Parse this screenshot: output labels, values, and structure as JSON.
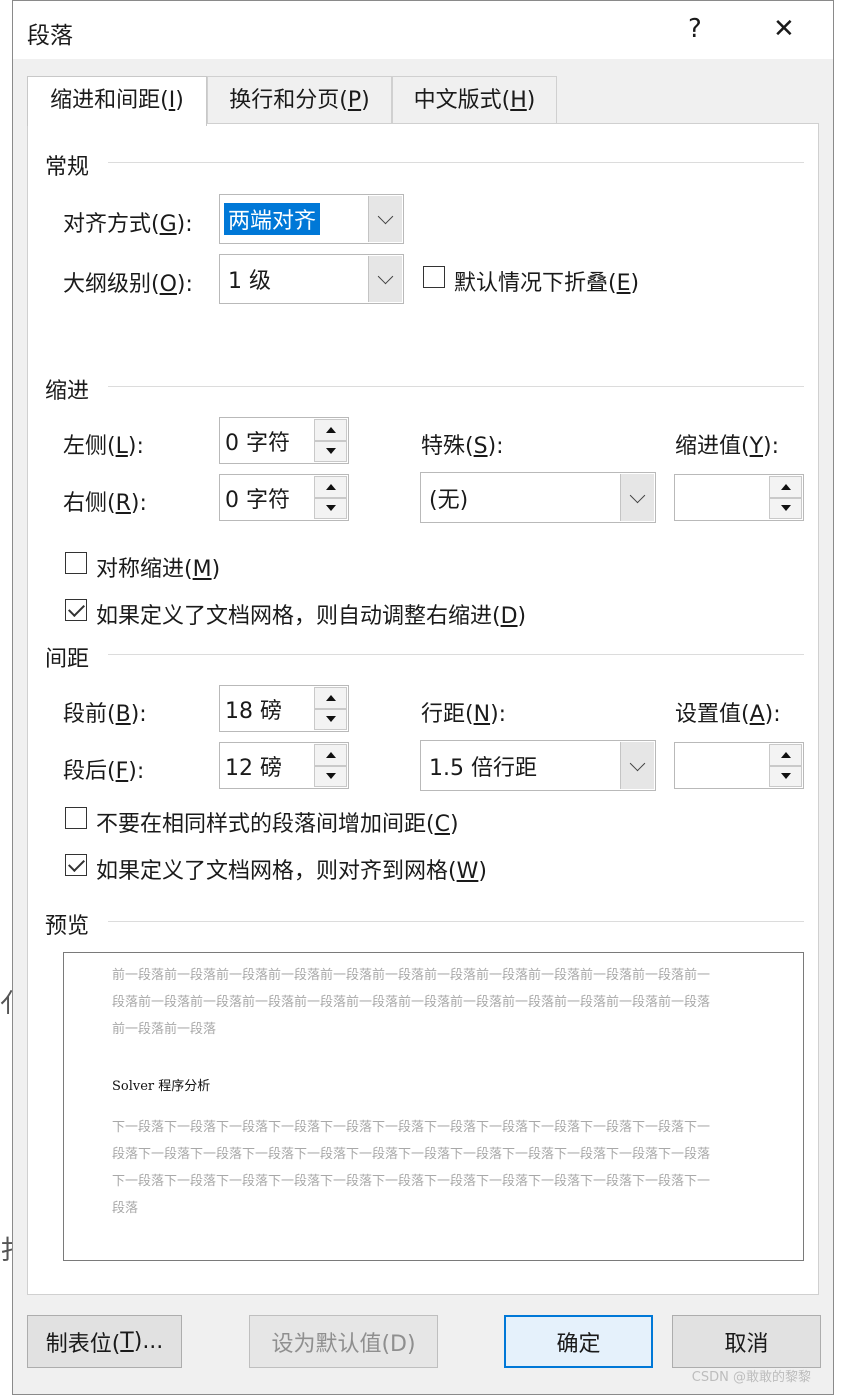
{
  "window": {
    "title": "段落",
    "help_label": "?",
    "close_label": "✕"
  },
  "tabs": [
    {
      "label": "缩进和间距(I)",
      "prefix": "缩进和间距(",
      "key": "I",
      "suffix": ")"
    },
    {
      "label": "换行和分页(P)",
      "prefix": "换行和分页(",
      "key": "P",
      "suffix": ")"
    },
    {
      "label": "中文版式(H)",
      "prefix": "中文版式(",
      "key": "H",
      "suffix": ")"
    }
  ],
  "general": {
    "section_title": "常规",
    "alignment": {
      "prefix": "对齐方式(",
      "key": "G",
      "suffix": "):",
      "value": "两端对齐"
    },
    "outline": {
      "prefix": "大纲级别(",
      "key": "O",
      "suffix": "):",
      "value": "1 级"
    },
    "collapse": {
      "prefix": "默认情况下折叠(",
      "key": "E",
      "suffix": ")",
      "checked": false
    }
  },
  "indent": {
    "section_title": "缩进",
    "left": {
      "prefix": "左侧(",
      "key": "L",
      "suffix": "):",
      "value": "0 字符"
    },
    "right": {
      "prefix": "右侧(",
      "key": "R",
      "suffix": "):",
      "value": "0 字符"
    },
    "special": {
      "prefix": "特殊(",
      "key": "S",
      "suffix": "):",
      "value": "(无)"
    },
    "indent_value": {
      "prefix": "缩进值(",
      "key": "Y",
      "suffix": "):",
      "value": ""
    },
    "mirror": {
      "prefix": "对称缩进(",
      "key": "M",
      "suffix": ")",
      "checked": false
    },
    "auto_adjust": {
      "prefix": "如果定义了文档网格，则自动调整右缩进(",
      "key": "D",
      "suffix": ")",
      "checked": true
    }
  },
  "spacing": {
    "section_title": "间距",
    "before": {
      "prefix": "段前(",
      "key": "B",
      "suffix": "):",
      "value": "18 磅"
    },
    "after": {
      "prefix": "段后(",
      "key": "F",
      "suffix": "):",
      "value": "12 磅"
    },
    "line_spacing": {
      "prefix": "行距(",
      "key": "N",
      "suffix": "):",
      "value": "1.5 倍行距"
    },
    "at": {
      "prefix": "设置值(",
      "key": "A",
      "suffix": "):",
      "value": ""
    },
    "no_space_same": {
      "prefix": "不要在相同样式的段落间增加间距(",
      "key": "C",
      "suffix": ")",
      "checked": false
    },
    "snap_grid": {
      "prefix": "如果定义了文档网格，则对齐到网格(",
      "key": "W",
      "suffix": ")",
      "checked": true
    }
  },
  "preview": {
    "section_title": "预览",
    "prev_text": "前一段落前一段落前一段落前一段落前一段落前一段落前一段落前一段落前一段落前一段落前一段落前一段落前一段落前一段落前一段落前一段落前一段落前一段落前一段落前一段落前一段落前一段落前一段落前一段落前一段落",
    "main_text": "Solver 程序分析",
    "next_text": "下一段落下一段落下一段落下一段落下一段落下一段落下一段落下一段落下一段落下一段落下一段落下一段落下一段落下一段落下一段落下一段落下一段落下一段落下一段落下一段落下一段落下一段落下一段落下一段落下一段落下一段落下一段落下一段落下一段落下一段落下一段落下一段落下一段落下一段落下一段落"
  },
  "buttons": {
    "tabs": {
      "prefix": "制表位(",
      "key": "T",
      "suffix": ")..."
    },
    "set_default": "设为默认值(D)",
    "ok": "确定",
    "cancel": "取消"
  },
  "background": {
    "ghost_char_1": "亻",
    "ghost_char_2": "扌"
  },
  "watermark": "CSDN @敢敢的黎黎",
  "colors": {
    "accent": "#0078d7",
    "dialog_bg": "#f0f0f0",
    "panel_bg": "#ffffff"
  }
}
